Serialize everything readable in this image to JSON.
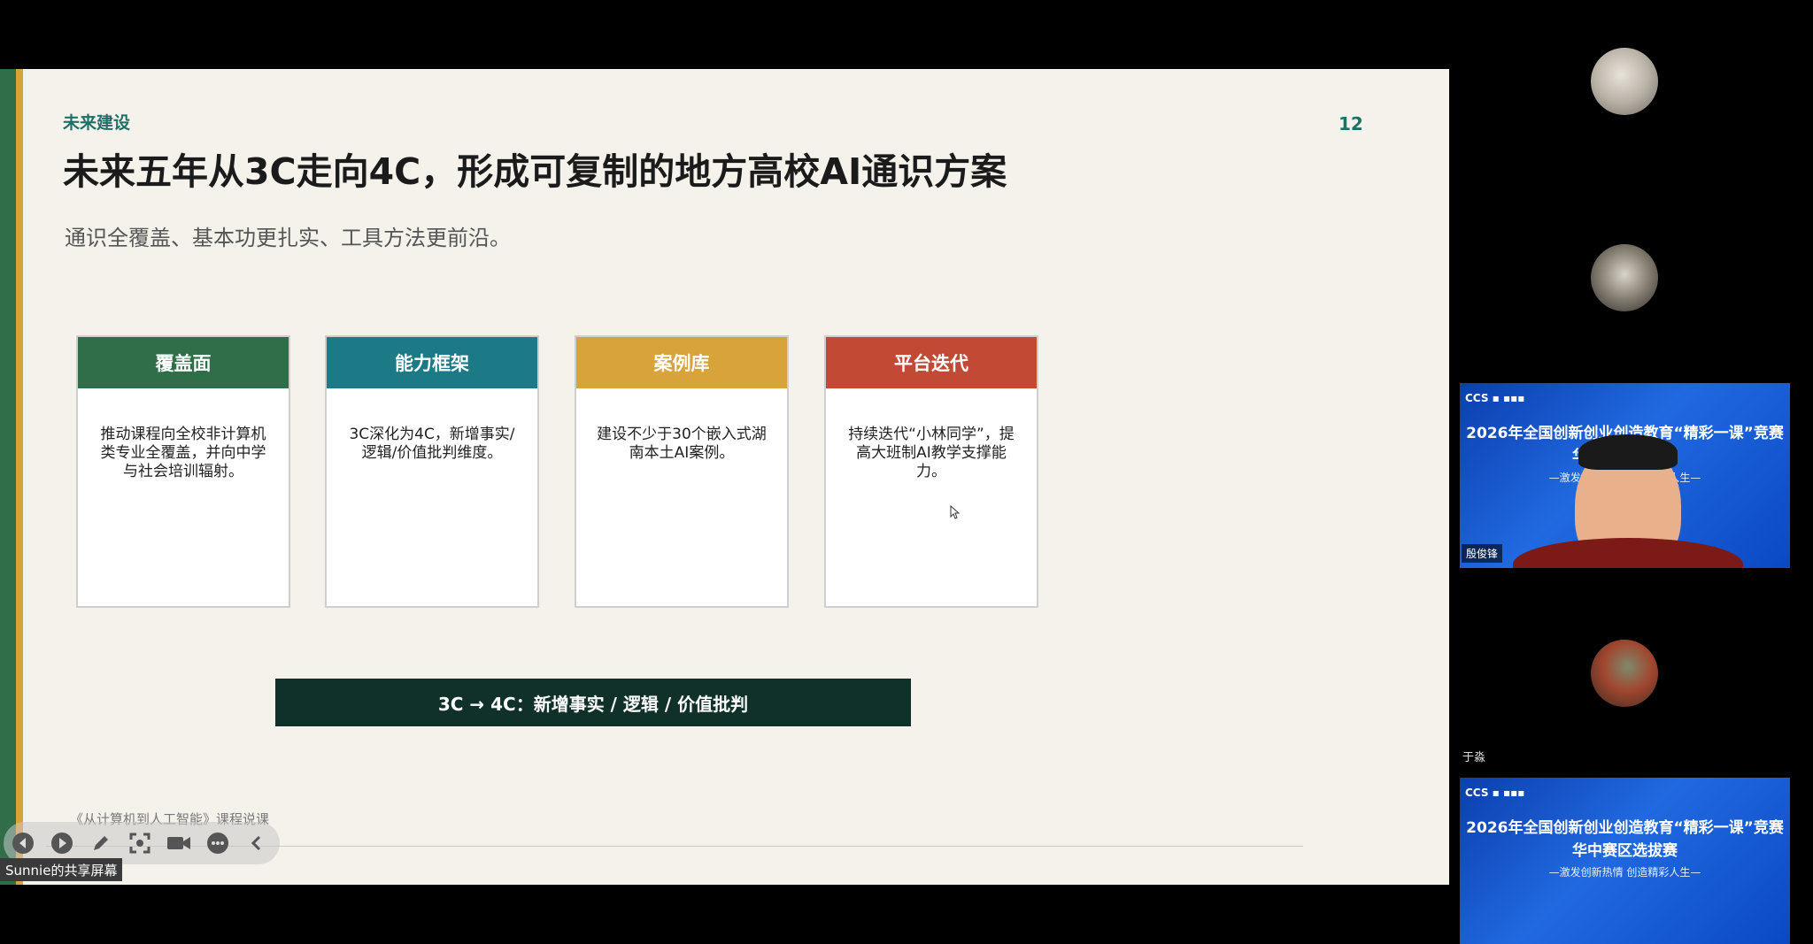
{
  "slide": {
    "section_label": "未来建设",
    "page_number": "12",
    "title": "未来五年从3C走向4C，形成可复制的地方高校AI通识方案",
    "subtitle": "通识全覆盖、基本功更扎实、工具方法更前沿。",
    "cards": [
      {
        "heading": "覆盖面",
        "body": "推动课程向全校非计算机类专业全覆盖，并向中学与社会培训辐射。",
        "color": "#2f6e49"
      },
      {
        "heading": "能力框架",
        "body": "3C深化为4C，新增事实/逻辑/价值批判维度。",
        "color": "#1c7a87"
      },
      {
        "heading": "案例库",
        "body": "建设不少于30个嵌入式湖南本土AI案例。",
        "color": "#d8a33a"
      },
      {
        "heading": "平台迭代",
        "body": "持续迭代“小林同学”，提高大班制AI教学支撑能力。",
        "color": "#c24a35"
      }
    ],
    "banner": "3C → 4C：新增事实 / 逻辑 / 价值批判",
    "footer": "《从计算机到人工智能》课程说课"
  },
  "share": {
    "label": "Sunnie的共享屏幕",
    "toolbar_icons": [
      "previous-icon",
      "play-icon",
      "pen-icon",
      "screenshot-icon",
      "camera-icon",
      "more-icon",
      "collapse-icon"
    ]
  },
  "participants": {
    "p3_name": "殷俊锋",
    "p4_name": "于淼",
    "video_headline_1": "2026年全国创新创业创造教育“精彩一课”竞赛",
    "video_headline_2": "华中赛区选拔赛",
    "video_slogan": "—激发创新热情 创造精彩人生—"
  }
}
